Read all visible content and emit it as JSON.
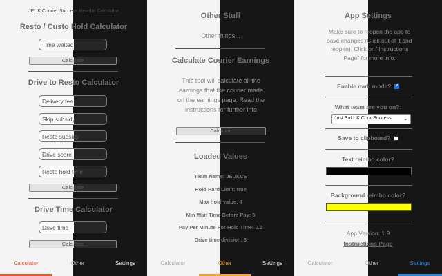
{
  "calculator": {
    "top_title": "JEUK Courier Success Reimbo Calculator",
    "hold_section": {
      "title": "Resto / Custo Hold Calculator",
      "time_waited_placeholder": "Time waited",
      "calculate_label": "Calculate"
    },
    "drive_to_resto_section": {
      "title": "Drive to Resto Calculator",
      "delivery_fee_placeholder": "Delivery fee",
      "skip_subsidy_placeholder": "Skip subsidy",
      "resto_subsidy_placeholder": "Resto subsidy",
      "drive_score_placeholder": "Drive score",
      "resto_hold_time_placeholder": "Resto hold time",
      "calculate_label": "Calculate"
    },
    "drive_time_section": {
      "title": "Drive Time Calculator",
      "drive_time_placeholder": "Drive time",
      "calculate_label": "Calculate"
    }
  },
  "other": {
    "other_stuff_title": "Other Stuff",
    "other_things_text": "Other things...",
    "courier_earnings_title": "Calculate Courier Earnings",
    "courier_earnings_description": "This tool will calculate all the earnings that the courier made on the earnings page. Read the instructions for further info",
    "calculate_label": "Calculate",
    "loaded_values_title": "Loaded Values",
    "loaded_values": [
      "Team Name: JEUKCS",
      "Hold Hard Limit: true",
      "Max hold value: 4",
      "Min Wait Time Before Pay: 5",
      "Pay Per Minute For Hold Time: 0.2",
      "Drive time division: 3"
    ]
  },
  "settings": {
    "title": "App Settings",
    "reopen_note": "Make sure to reopen the app to save changes (Click out of it and reopen). Click on \"Instructions Page\" for more info.",
    "dark_mode_label": "Enable dark mode?",
    "dark_mode_checked": true,
    "team_label": "What team are you on?:",
    "team_selected": "Just Eat UK Cour Success",
    "clipboard_label": "Save to clipboard?",
    "clipboard_checked": false,
    "text_color_label": "Text reimbo color?",
    "text_color_value": "#000000",
    "background_color_label": "Background reimbo color?",
    "background_color_value": "#ffff00",
    "app_version": "App Version: 1.9",
    "instructions_link": "Instructions Page"
  },
  "nav_panels": [
    {
      "calculator": "Calculator",
      "other": "Other",
      "settings": "Settings",
      "active": "calculator"
    },
    {
      "calculator": "Calculator",
      "other": "Other",
      "settings": "Settings",
      "active": "other"
    },
    {
      "calculator": "Calculator",
      "other": "Other",
      "settings": "Settings",
      "active": "settings"
    }
  ],
  "colors": {
    "calculator_accent": "#e8572a",
    "other_accent": "#f5a623",
    "settings_accent": "#1e88e5"
  }
}
